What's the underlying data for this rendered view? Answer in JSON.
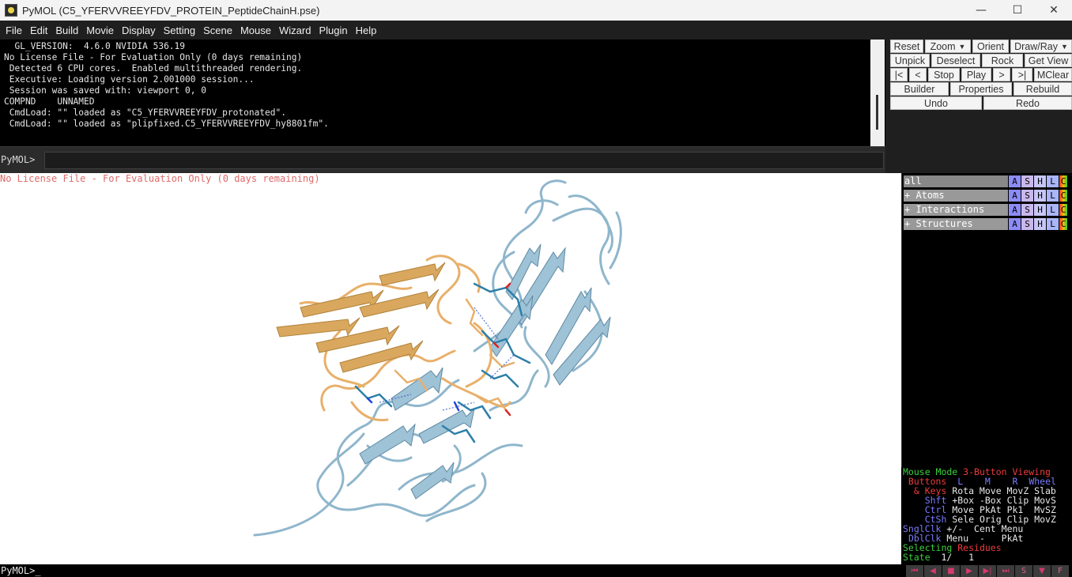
{
  "window": {
    "title": "PyMOL (C5_YFERVVREEYFDV_PROTEIN_PeptideChainH.pse)",
    "minimize": "—",
    "maximize": "☐",
    "close": "✕"
  },
  "menu": [
    "File",
    "Edit",
    "Build",
    "Movie",
    "Display",
    "Setting",
    "Scene",
    "Mouse",
    "Wizard",
    "Plugin",
    "Help"
  ],
  "log": [
    "  GL_VERSION:  4.6.0 NVIDIA 536.19",
    "No License File - For Evaluation Only (0 days remaining)",
    " Detected 6 CPU cores.  Enabled multithreaded rendering.",
    " Executive: Loading version 2.001000 session...",
    " Session was saved with: viewport 0, 0",
    "COMPND    UNNAMED",
    " CmdLoad: \"\" loaded as \"C5_YFERVVREEYFDV_protonated\".",
    " CmdLoad: \"\" loaded as \"plipfixed.C5_YFERVVREEYFDV_hy8801fm\"."
  ],
  "command": {
    "prompt": "PyMOL>",
    "value": ""
  },
  "buttons": {
    "reset": "Reset",
    "zoom": "Zoom",
    "orient": "Orient",
    "draw_ray": "Draw/Ray",
    "unpick": "Unpick",
    "deselect": "Deselect",
    "rock": "Rock",
    "get_view": "Get View",
    "first": "|<",
    "prev": "<",
    "stop": "Stop",
    "play": "Play",
    "next": ">",
    "last": ">|",
    "mclear": "MClear",
    "builder": "Builder",
    "properties": "Properties",
    "rebuild": "Rebuild",
    "undo": "Undo",
    "redo": "Redo"
  },
  "viewer": {
    "license_text": "No License File - For Evaluation Only (0 days remaining)"
  },
  "objects": [
    {
      "name": "all",
      "expander": ""
    },
    {
      "name": "Atoms",
      "expander": "+"
    },
    {
      "name": "Interactions",
      "expander": "+"
    },
    {
      "name": "Structures",
      "expander": "+"
    }
  ],
  "object_buttons": [
    "A",
    "S",
    "H",
    "L",
    "C"
  ],
  "mouse_info": {
    "mode_label": "Mouse Mode ",
    "mode_value": "3-Button Viewing",
    "buttons_label": " Buttons ",
    "col_l": " L",
    "col_m": "M",
    "col_r": "R",
    "col_wheel": "Wheel",
    "keys_label": "  & Keys ",
    "keys_row": "Rota Move MovZ Slab",
    "shft_label": "Shft",
    "shft_row": "+Box -Box Clip MovS",
    "ctrl_label": "Ctrl",
    "ctrl_row": "Move PkAt Pk1  MvSZ",
    "ctsh_label": "CtSh",
    "ctsh_row": "Sele Orig Clip MovZ",
    "sngl_label": "SnglClk",
    "sngl_row": "+/-  Cent Menu",
    "dbl_label": "DblClk",
    "dbl_row": "Menu  -   PkAt",
    "selecting_label": "Selecting ",
    "selecting_value": "Residues",
    "state_label": "State",
    "state_value": "  1/   1"
  },
  "bottom_prompt": "PyMOL>_",
  "playback": [
    "⏮",
    "◀",
    "■",
    "▶",
    "▶|",
    "⏭",
    "S",
    "▼",
    "F"
  ]
}
